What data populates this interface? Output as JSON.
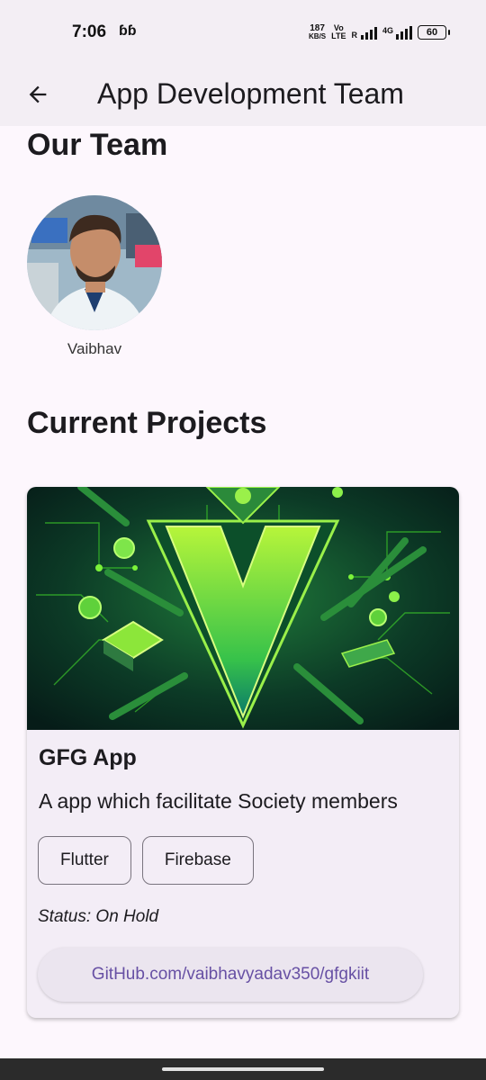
{
  "status_bar": {
    "time": "7:06",
    "notification_icon": "b-icon",
    "net_speed_value": "187",
    "net_speed_unit": "KB/S",
    "volte_line1": "Vo",
    "volte_line2": "LTE",
    "sim1_label": "R",
    "sim2_label": "4G",
    "battery": "60"
  },
  "app_bar": {
    "back_icon": "arrow-back-icon",
    "title": "App Development Team"
  },
  "team": {
    "heading": "Our Team",
    "members": [
      {
        "name": "Vaibhav"
      }
    ]
  },
  "projects": {
    "heading": "Current Projects",
    "items": [
      {
        "title": "GFG App",
        "description": "A app which facilitate Society members",
        "tags": [
          "Flutter",
          "Firebase"
        ],
        "status": "Status: On Hold",
        "link": "GitHub.com/vaibhavyadav350/gfgkiit"
      }
    ]
  },
  "colors": {
    "background": "#fdf7fd",
    "app_bar": "#f3eef4",
    "card": "#f3edf6",
    "link_text": "#6750a4",
    "project_image_green": "#3fcf2a"
  }
}
